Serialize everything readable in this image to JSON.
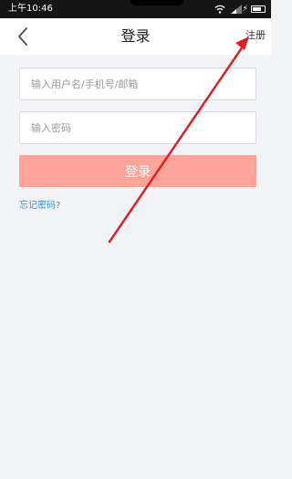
{
  "status_bar": {
    "time": "上午10:46",
    "charging_symbol": "⚡",
    "icons": [
      "wifi-icon",
      "signal-icon",
      "charging-icon",
      "battery-icon"
    ]
  },
  "header": {
    "title": "登录",
    "back_icon": "chevron-left-icon",
    "register_label": "注册"
  },
  "form": {
    "username_placeholder": "输入用户名/手机号/邮箱",
    "password_placeholder": "输入密码",
    "login_label": "登录",
    "forgot_label": "忘记密码?"
  },
  "colors": {
    "login_button": "#fda49a",
    "forgot_link": "#3a8ecf",
    "annotation_arrow": "#e02020"
  }
}
